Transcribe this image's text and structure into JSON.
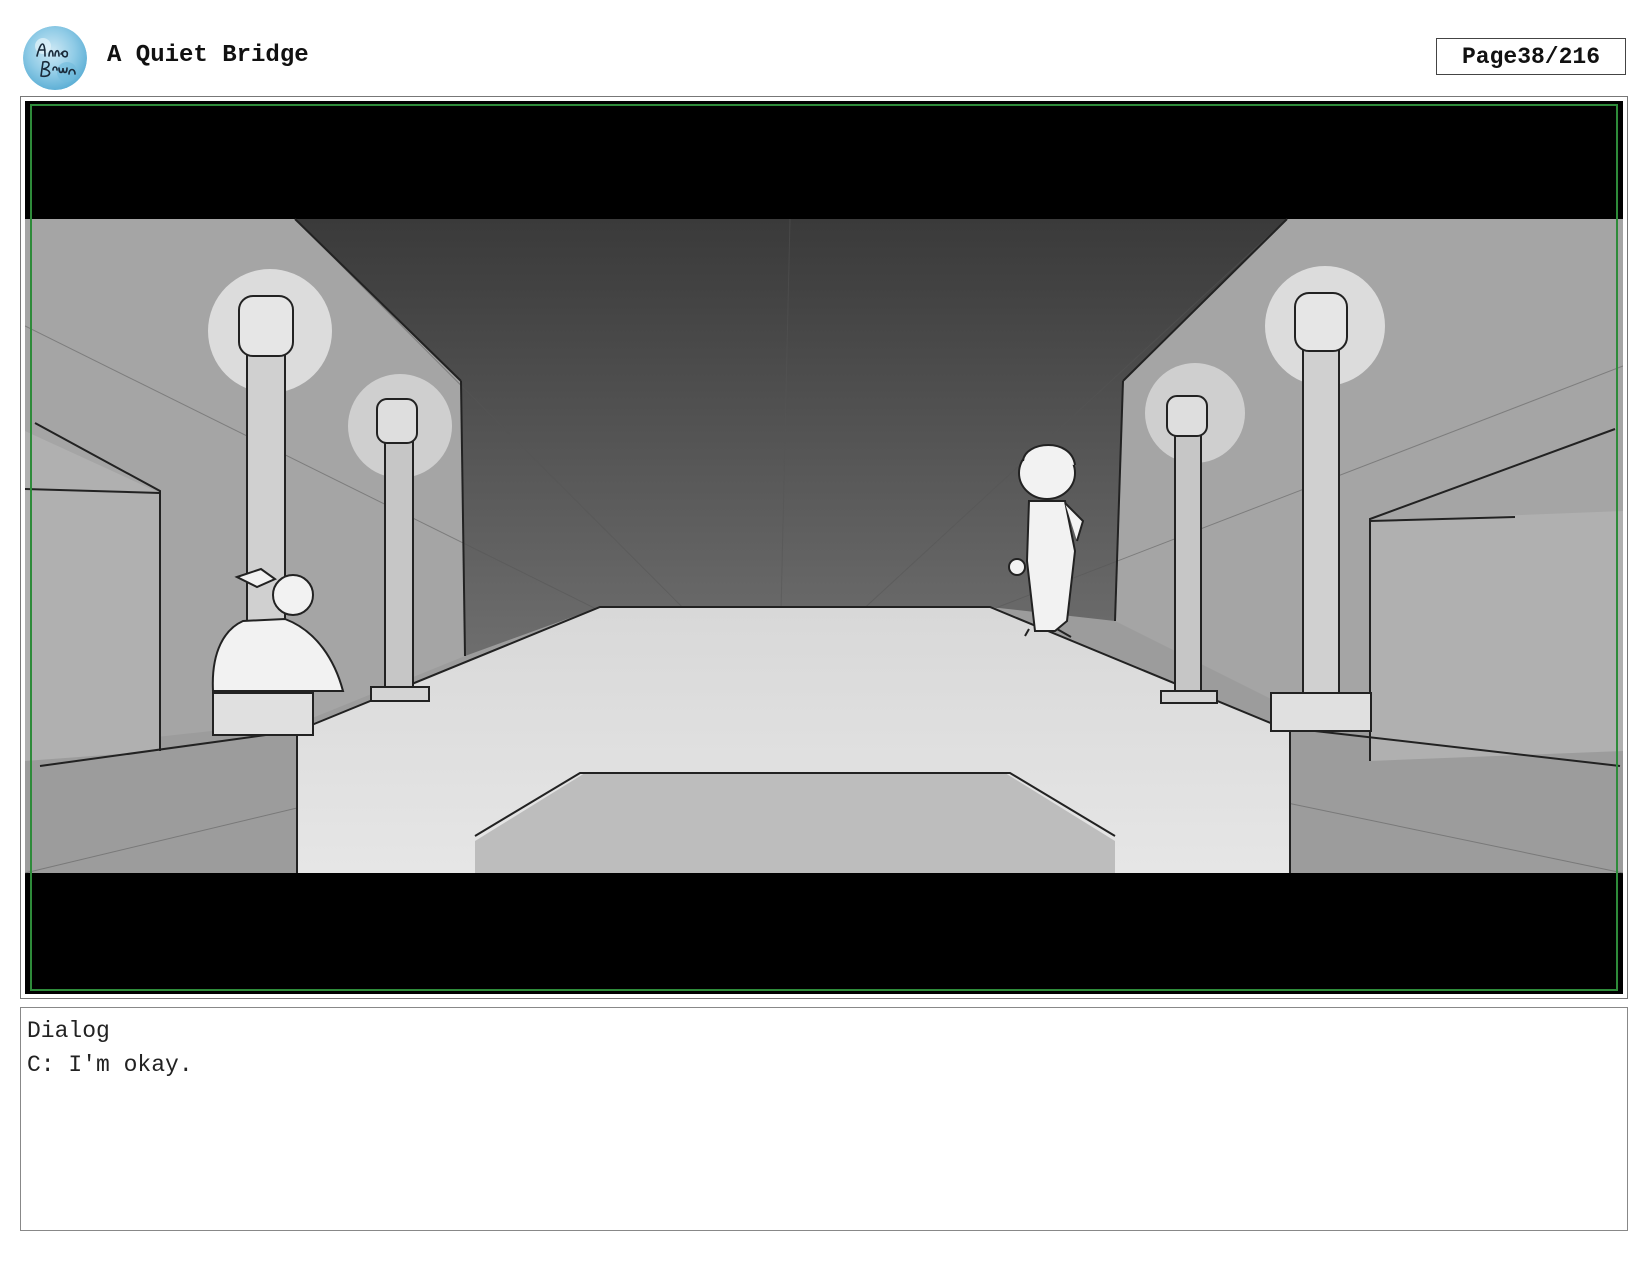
{
  "header": {
    "logo_text": "Anna Brown",
    "title": "A Quiet Bridge",
    "page_label": "Page",
    "page_number": "38/216"
  },
  "panel": {
    "icon": "storyboard-sketch-panel"
  },
  "dialog": {
    "heading": "Dialog",
    "line": "C: I'm okay."
  },
  "colors": {
    "frame_border": "#2e8b3a",
    "letterbox": "#000000",
    "logo_bg": "#8fcbe6"
  }
}
